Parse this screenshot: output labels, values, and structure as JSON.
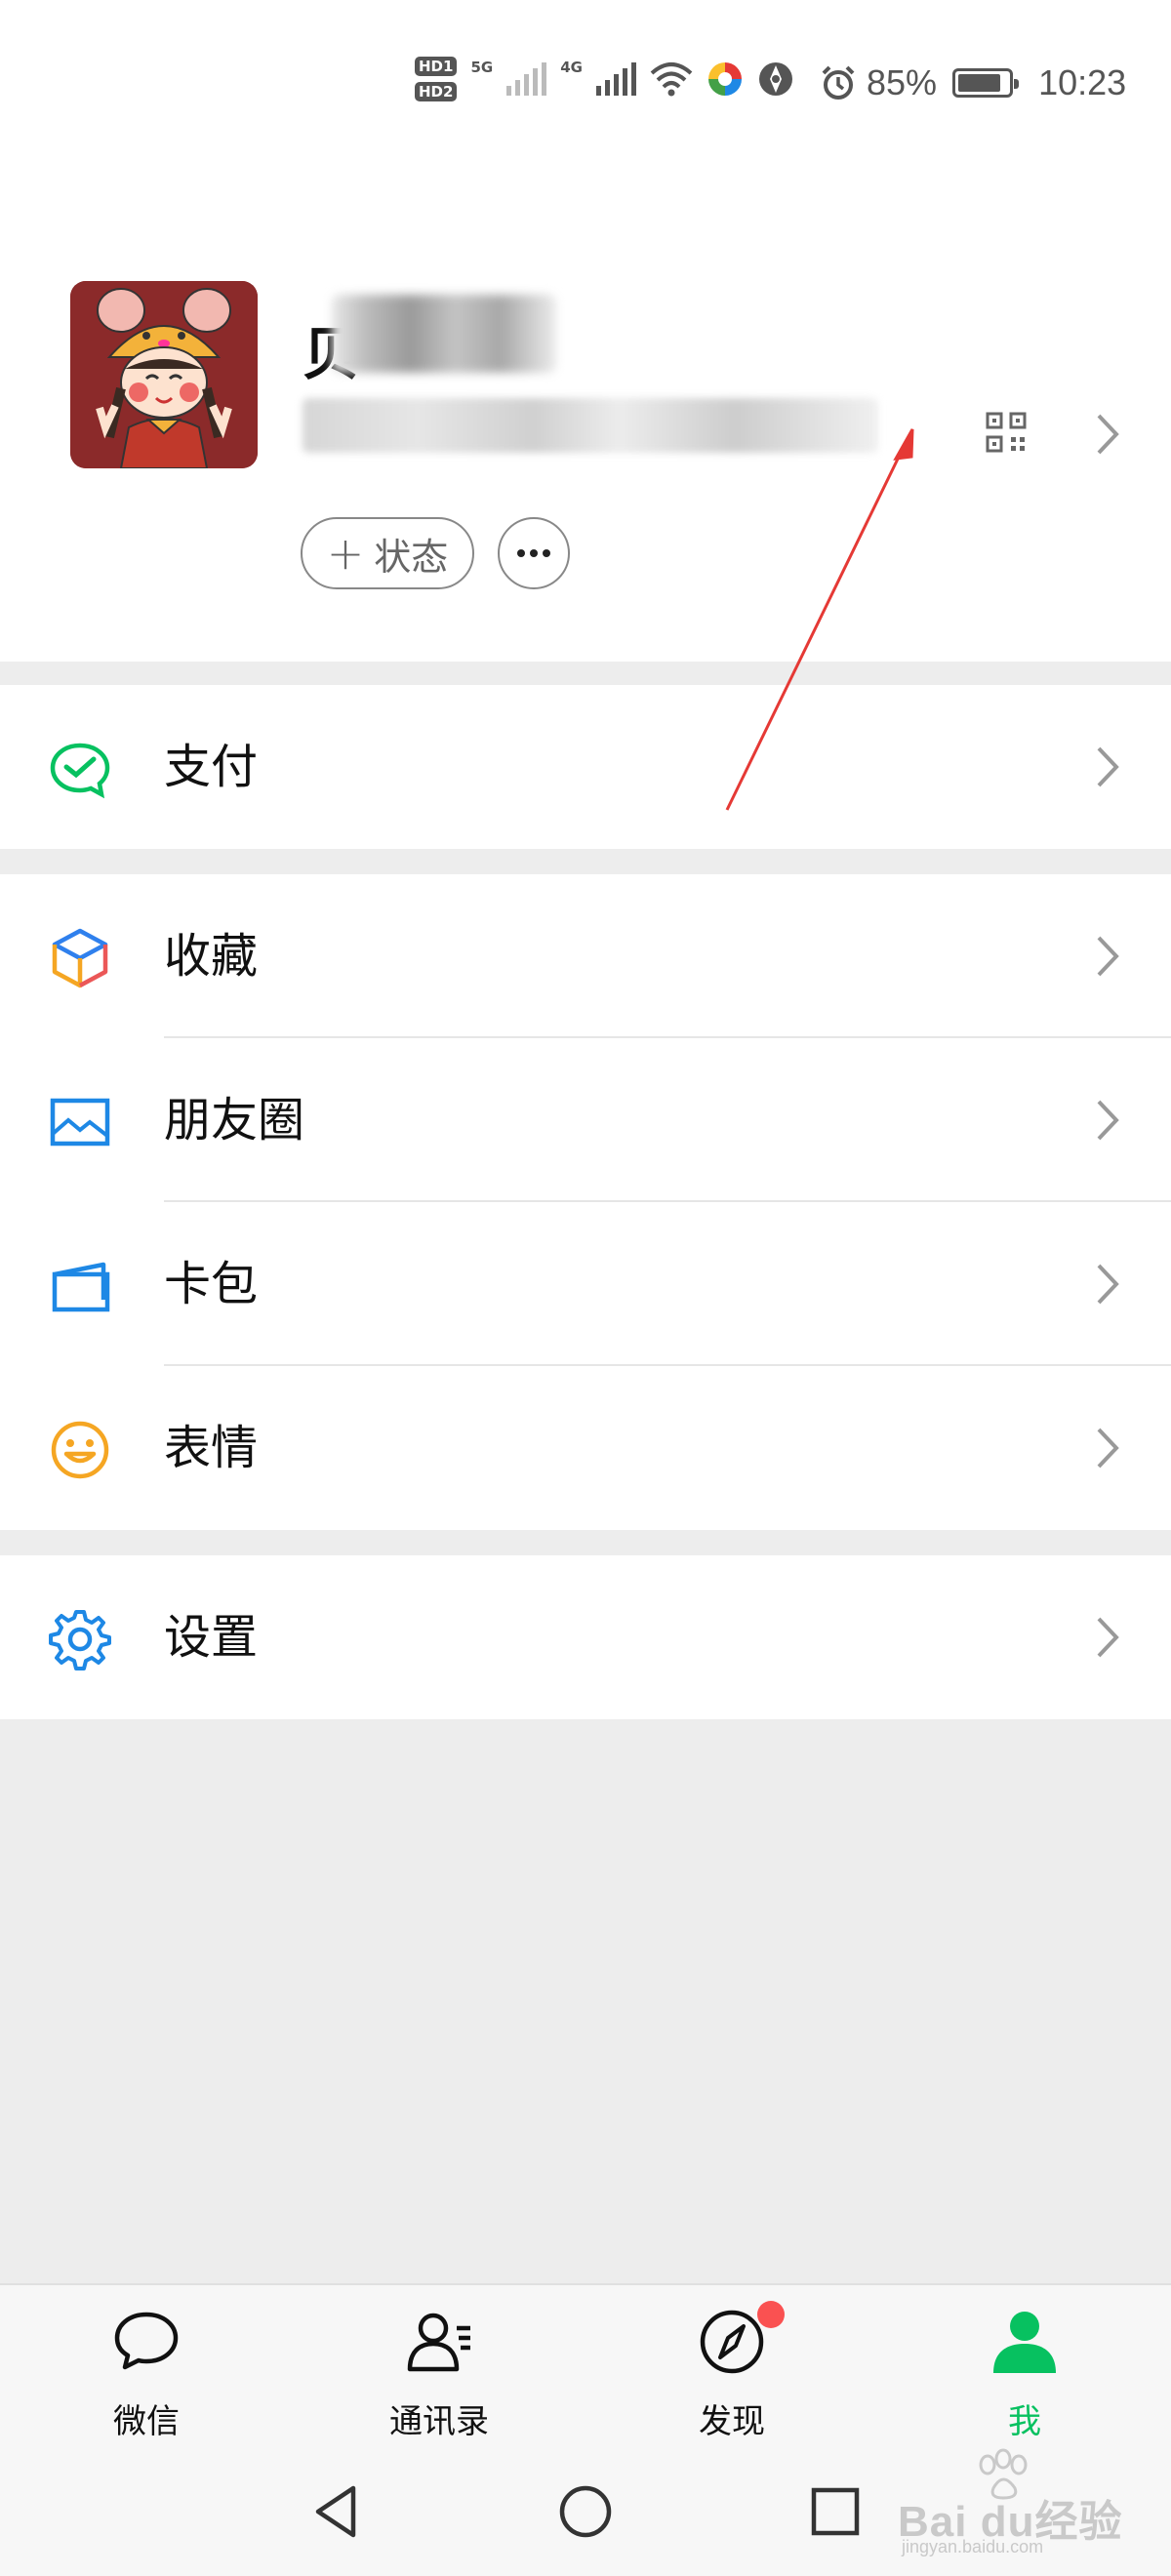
{
  "status_bar": {
    "hd1": "HD1",
    "hd2": "HD2",
    "net1": "5G",
    "net2": "4G",
    "alarm_icon": "alarm-icon",
    "battery_text": "85%",
    "battery_level": 0.85,
    "time": "10:23"
  },
  "profile": {
    "nickname_visible_char": "贝",
    "qr_icon": "qr-code-icon",
    "status_button_label": "状态",
    "more_icon": "more-dots-icon"
  },
  "menu": {
    "pay": {
      "label": "支付",
      "icon": "wechat-pay-icon",
      "color": "#07c160"
    },
    "favorites": {
      "label": "收藏",
      "icon": "favorites-cube-icon"
    },
    "moments": {
      "label": "朋友圈",
      "icon": "moments-picture-icon",
      "color": "#1e88e5"
    },
    "cards": {
      "label": "卡包",
      "icon": "card-wallet-icon",
      "color": "#1e88e5"
    },
    "stickers": {
      "label": "表情",
      "icon": "smiley-icon",
      "color": "#f5a623"
    },
    "settings": {
      "label": "设置",
      "icon": "gear-icon",
      "color": "#1e88e5"
    }
  },
  "tabs": [
    {
      "label": "微信",
      "icon": "chat-bubble-icon",
      "active": false
    },
    {
      "label": "通讯录",
      "icon": "contacts-icon",
      "active": false
    },
    {
      "label": "发现",
      "icon": "compass-icon",
      "active": false,
      "badge": true
    },
    {
      "label": "我",
      "icon": "person-icon",
      "active": true
    }
  ],
  "nav": {
    "back_icon": "back-triangle-icon",
    "home_icon": "home-circle-icon",
    "recents_icon": "recents-square-icon"
  },
  "colors": {
    "accent": "#07c160",
    "annotation_arrow": "#e53935",
    "badge": "#fa5151",
    "background": "#ededed"
  },
  "watermark": {
    "brand": "Bai du经验",
    "url": "jingyan.baidu.com"
  }
}
